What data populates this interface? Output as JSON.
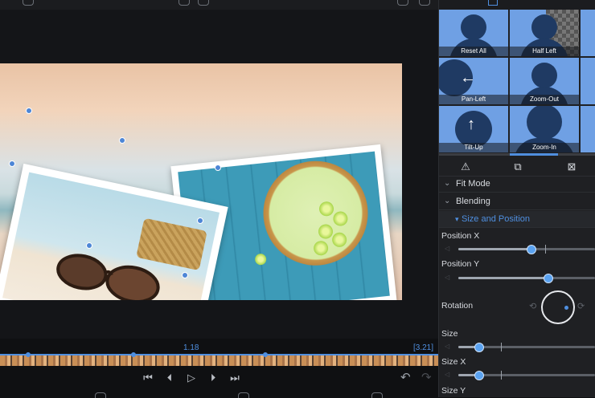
{
  "timeline": {
    "current_time": "1.18",
    "total_time": "[3.21]"
  },
  "effects": {
    "thumbnails": [
      {
        "label": "Reset All",
        "icon": "person-icon"
      },
      {
        "label": "Half Left",
        "icon": "person-icon"
      },
      {
        "label": "Pan-Left",
        "icon": "arrow-left-icon"
      },
      {
        "label": "Zoom-Out",
        "icon": "person-icon"
      },
      {
        "label": "Tilt-Up",
        "icon": "arrow-up-icon"
      },
      {
        "label": "Zoom-In",
        "icon": "person-icon"
      }
    ]
  },
  "panel": {
    "sections": {
      "fit_mode": "Fit Mode",
      "blending": "Blending",
      "size_position": "Size and Position"
    },
    "properties": {
      "position_x": {
        "label": "Position X",
        "value": 0.52
      },
      "position_y": {
        "label": "Position Y",
        "value": 0.66
      },
      "rotation": {
        "label": "Rotation"
      },
      "size": {
        "label": "Size",
        "value": 0.15
      },
      "size_x": {
        "label": "Size X",
        "value": 0.15
      },
      "size_y": {
        "label": "Size Y"
      }
    }
  },
  "colors": {
    "accent": "#4f8fe0",
    "thumbnail_bg": "#6fa0e4",
    "panel_bg": "#1f2023"
  }
}
